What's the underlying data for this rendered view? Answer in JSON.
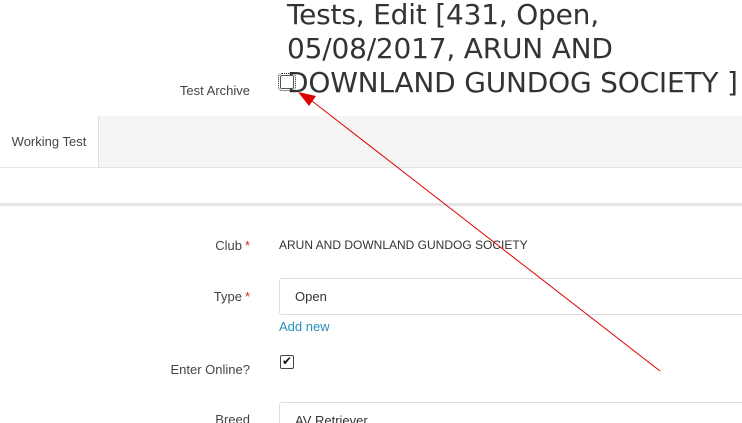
{
  "page": {
    "title": "Tests, Edit [431, Open, 05/08/2017, ARUN AND DOWNLAND GUNDOG SOCIETY ]"
  },
  "archive": {
    "label": "Test Archive",
    "checked": false
  },
  "tabs": [
    {
      "label": "Working Test",
      "active": true
    }
  ],
  "form": {
    "club": {
      "label": "Club",
      "required_mark": "*",
      "value": "ARUN AND DOWNLAND GUNDOG SOCIETY"
    },
    "type": {
      "label": "Type",
      "required_mark": "*",
      "value": "Open",
      "add_new_label": "Add new"
    },
    "enter_online": {
      "label": "Enter Online?",
      "checked": true,
      "check_glyph": "✔"
    },
    "breed": {
      "label": "Breed",
      "value": "AV Retriever"
    }
  },
  "annotation": {
    "arrow_color": "#e00000"
  },
  "colors": {
    "required": "#c9302c",
    "link": "#2a8fbd",
    "tab_bar": "#f5f5f5"
  }
}
